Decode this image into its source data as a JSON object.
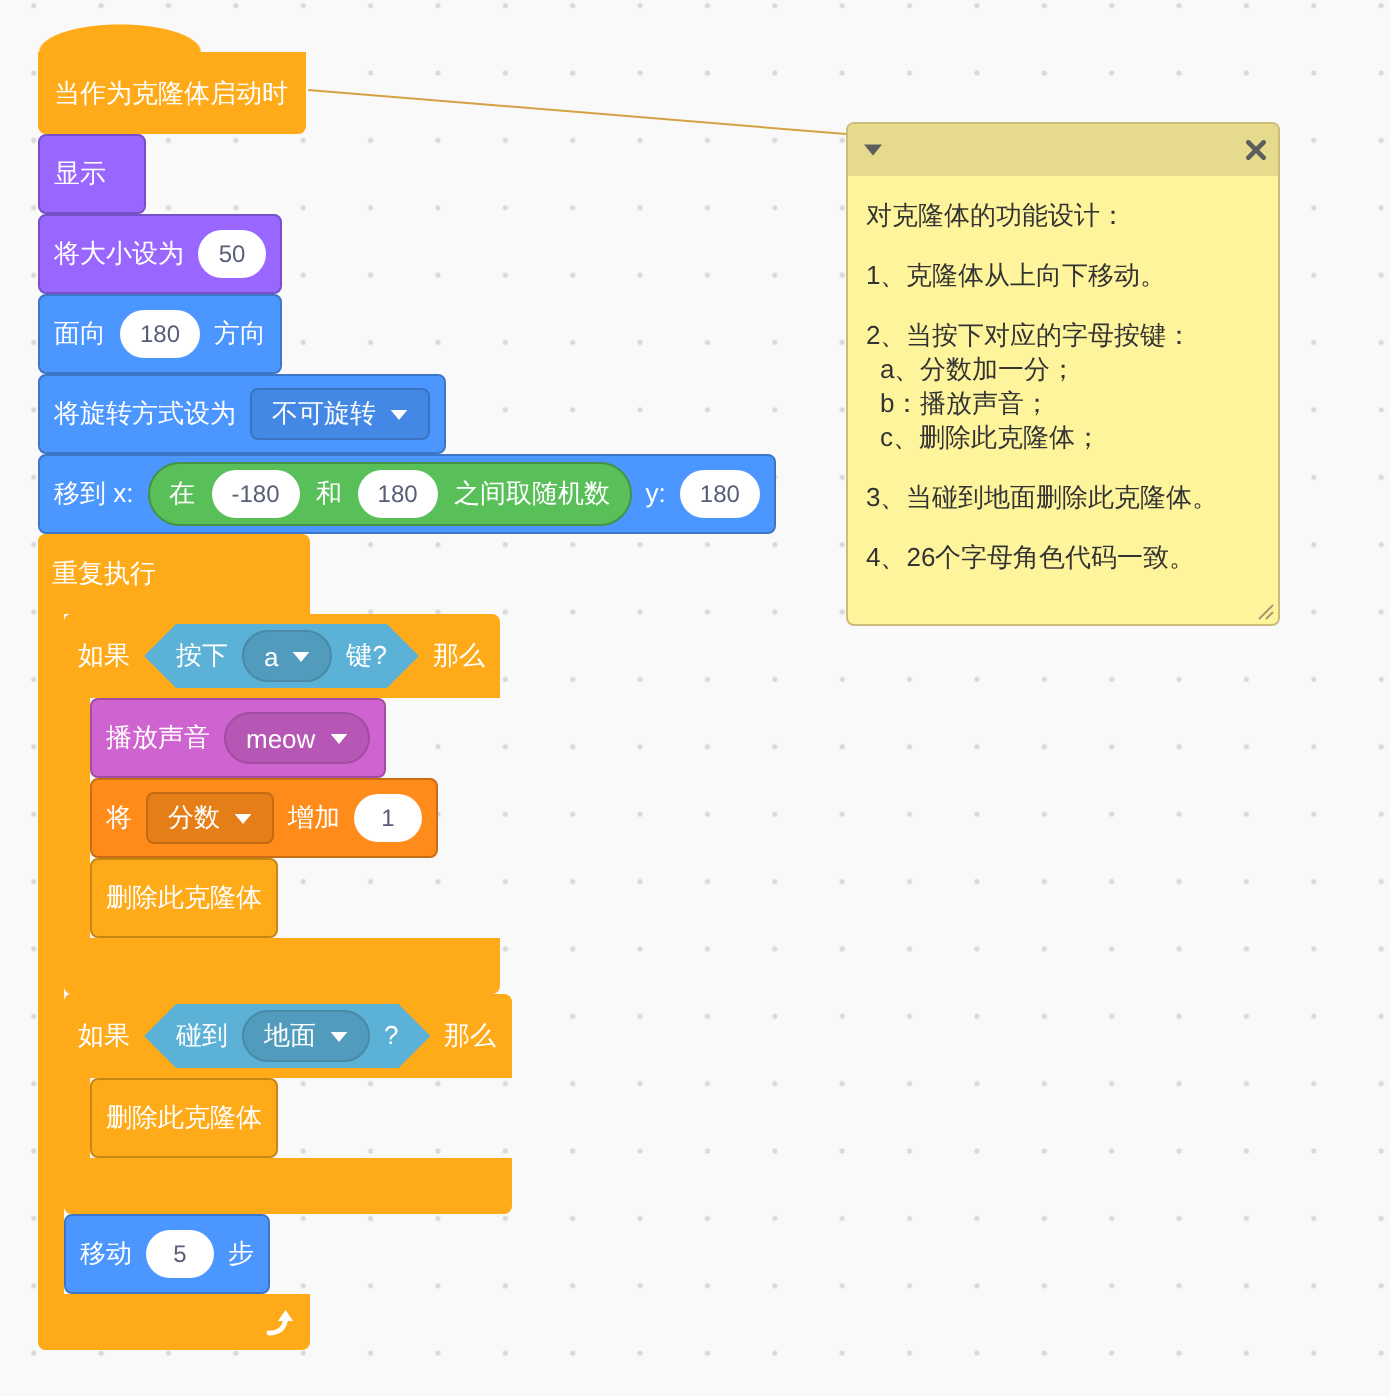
{
  "script": {
    "blocks": [
      {
        "kind": "hat",
        "color": "#FFAB19",
        "parts": [
          {
            "kind": "text",
            "text": "当作为克隆体启动时"
          }
        ]
      },
      {
        "kind": "stack",
        "color": "#9966FF",
        "parts": [
          {
            "kind": "text",
            "text": "显示"
          }
        ]
      },
      {
        "kind": "stack",
        "color": "#9966FF",
        "parts": [
          {
            "kind": "text",
            "text": "将大小设为"
          },
          {
            "kind": "number",
            "value": "50"
          }
        ]
      },
      {
        "kind": "stack",
        "color": "#4C97FF",
        "parts": [
          {
            "kind": "text",
            "text": "面向"
          },
          {
            "kind": "number",
            "value": "180"
          },
          {
            "kind": "text",
            "text": "方向"
          }
        ]
      },
      {
        "kind": "stack",
        "color": "#4C97FF",
        "parts": [
          {
            "kind": "text",
            "text": "将旋转方式设为"
          },
          {
            "kind": "dropdown",
            "value": "不可旋转"
          }
        ]
      },
      {
        "kind": "stack",
        "color": "#4C97FF",
        "parts": [
          {
            "kind": "text",
            "text": "移到 x:"
          },
          {
            "kind": "reporter",
            "color": "#59C059",
            "parts": [
              {
                "kind": "text",
                "text": "在"
              },
              {
                "kind": "number",
                "value": "-180"
              },
              {
                "kind": "text",
                "text": "和"
              },
              {
                "kind": "number",
                "value": "180"
              },
              {
                "kind": "text",
                "text": "之间取随机数"
              }
            ]
          },
          {
            "kind": "text",
            "text": "y:"
          },
          {
            "kind": "number",
            "value": "180"
          }
        ]
      },
      {
        "kind": "forever",
        "parts": [
          {
            "kind": "text",
            "text": "重复执行"
          }
        ],
        "children": [
          {
            "kind": "if",
            "parts": [
              {
                "kind": "text",
                "text": "如果"
              },
              {
                "kind": "boolean",
                "color": "#5CB1D6",
                "parts": [
                  {
                    "kind": "text",
                    "text": "按下"
                  },
                  {
                    "kind": "menu",
                    "value": "a"
                  },
                  {
                    "kind": "text",
                    "text": "键?"
                  }
                ]
              },
              {
                "kind": "text",
                "text": "那么"
              }
            ],
            "children": [
              {
                "kind": "stack",
                "color": "#CF63CF",
                "parts": [
                  {
                    "kind": "text",
                    "text": "播放声音"
                  },
                  {
                    "kind": "menu",
                    "value": "meow"
                  }
                ]
              },
              {
                "kind": "stack",
                "color": "#FF8C1A",
                "parts": [
                  {
                    "kind": "text",
                    "text": "将"
                  },
                  {
                    "kind": "dropdown",
                    "value": "分数"
                  },
                  {
                    "kind": "text",
                    "text": "增加"
                  },
                  {
                    "kind": "number",
                    "value": "1"
                  }
                ]
              },
              {
                "kind": "stack",
                "color": "#FFAB19",
                "parts": [
                  {
                    "kind": "text",
                    "text": "删除此克隆体"
                  }
                ]
              }
            ]
          },
          {
            "kind": "if",
            "parts": [
              {
                "kind": "text",
                "text": "如果"
              },
              {
                "kind": "boolean",
                "color": "#5CB1D6",
                "parts": [
                  {
                    "kind": "text",
                    "text": "碰到"
                  },
                  {
                    "kind": "menu",
                    "value": "地面"
                  },
                  {
                    "kind": "text",
                    "text": "?"
                  }
                ]
              },
              {
                "kind": "text",
                "text": "那么"
              }
            ],
            "children": [
              {
                "kind": "stack",
                "color": "#FFAB19",
                "parts": [
                  {
                    "kind": "text",
                    "text": "删除此克隆体"
                  }
                ]
              }
            ]
          },
          {
            "kind": "stack",
            "color": "#4C97FF",
            "parts": [
              {
                "kind": "text",
                "text": "移动"
              },
              {
                "kind": "number",
                "value": "5"
              },
              {
                "kind": "text",
                "text": "步"
              }
            ]
          }
        ]
      }
    ]
  },
  "comment": {
    "expanded": true,
    "paragraphs": [
      {
        "text": "对克隆体的功能设计："
      },
      {
        "text": "1、克隆体从上向下移动。"
      },
      {
        "text": "2、当按下对应的字母按键：",
        "items": [
          "a、分数加一分；",
          "b：播放声音；",
          "c、删除此克隆体；"
        ]
      },
      {
        "text": "3、当碰到地面删除此克隆体。"
      },
      {
        "text": "4、26个字母角色代码一致。"
      }
    ]
  }
}
